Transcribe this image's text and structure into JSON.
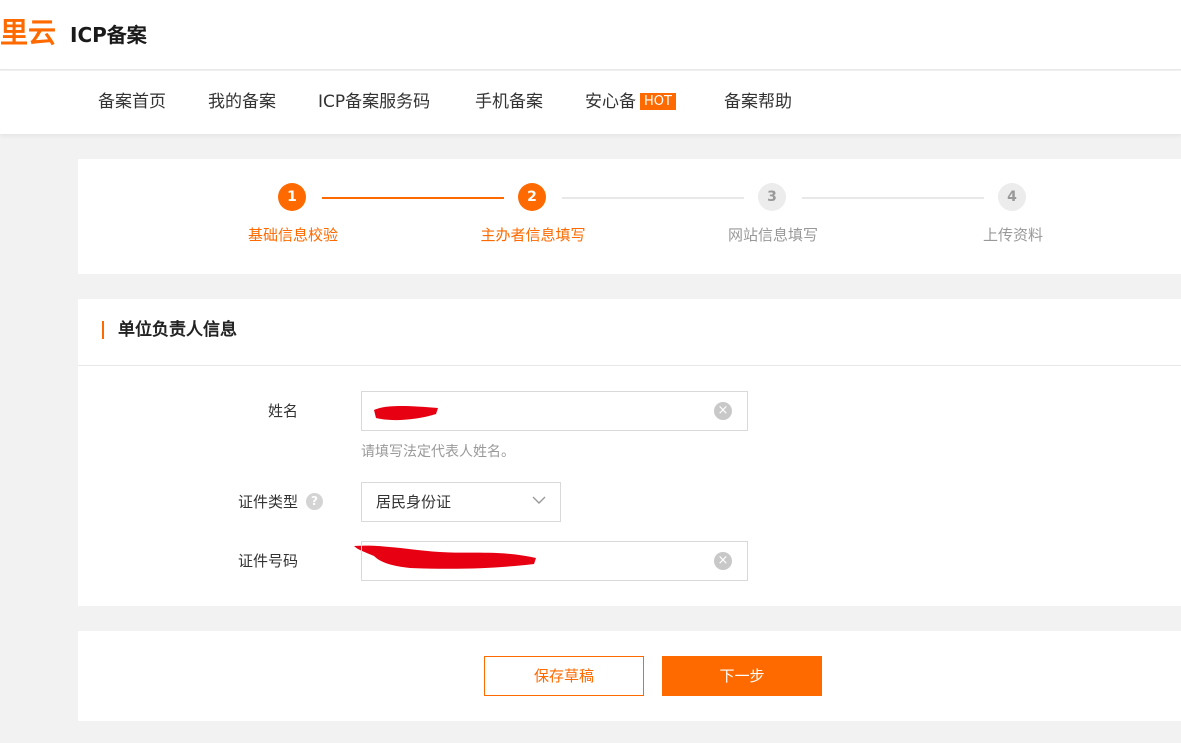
{
  "header": {
    "logo_text": "里云",
    "title": "ICP备案"
  },
  "nav": {
    "items": [
      {
        "label": "备案首页"
      },
      {
        "label": "我的备案"
      },
      {
        "label": "ICP备案服务码"
      },
      {
        "label": "手机备案"
      },
      {
        "label": "安心备",
        "badge": "HOT"
      },
      {
        "label": "备案帮助"
      }
    ]
  },
  "steps": [
    {
      "number": "1",
      "label": "基础信息校验",
      "state": "done"
    },
    {
      "number": "2",
      "label": "主办者信息填写",
      "state": "current"
    },
    {
      "number": "3",
      "label": "网站信息填写",
      "state": "todo"
    },
    {
      "number": "4",
      "label": "上传资料",
      "state": "todo"
    }
  ],
  "section": {
    "title": "单位负责人信息"
  },
  "form": {
    "name": {
      "label": "姓名",
      "hint": "请填写法定代表人姓名。"
    },
    "id_type": {
      "label": "证件类型",
      "value": "居民身份证"
    },
    "id_number": {
      "label": "证件号码"
    }
  },
  "actions": {
    "save_draft": "保存草稿",
    "next": "下一步"
  },
  "colors": {
    "accent": "#ff6a00",
    "redaction": "#e60012"
  },
  "icons": {
    "clear": "clear-circle-icon",
    "help": "question-circle-icon",
    "dropdown": "chevron-down-icon"
  }
}
